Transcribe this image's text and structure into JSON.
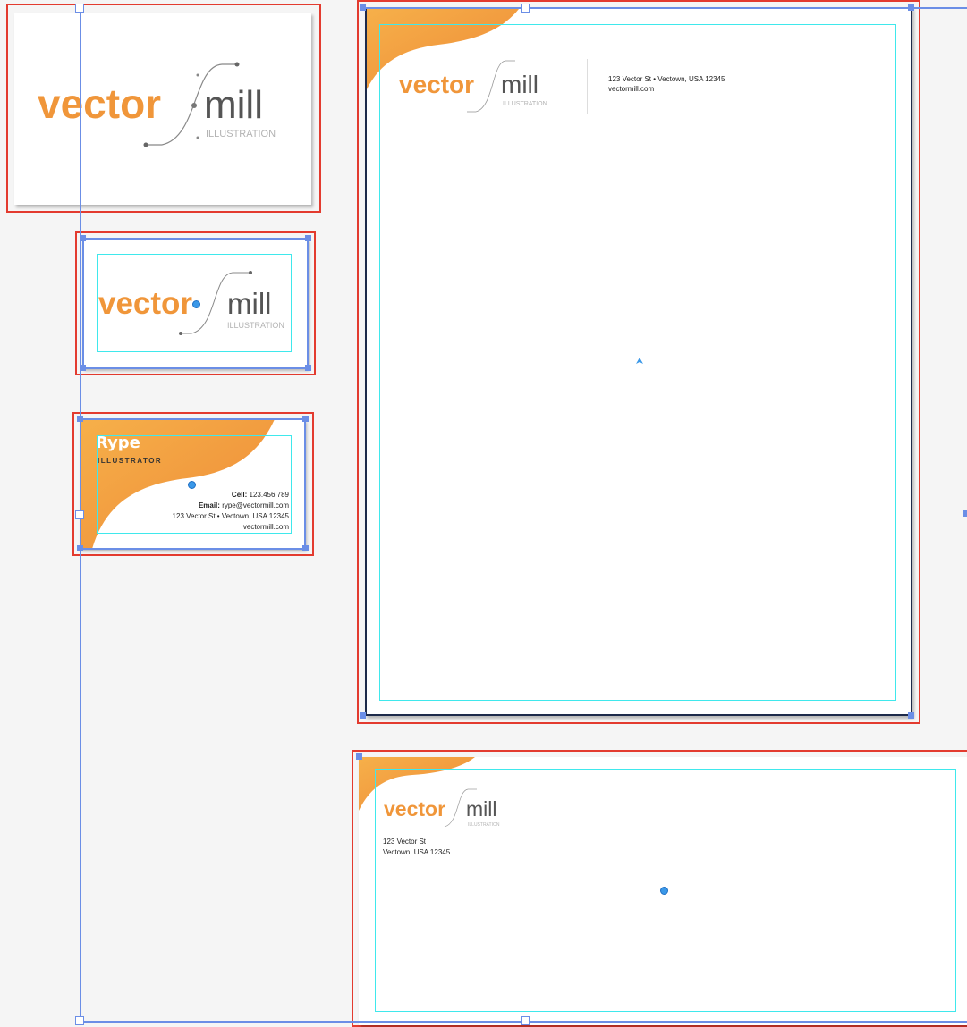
{
  "logo": {
    "word1": "vector",
    "word2": "mill",
    "tagline": "ILLUSTRATION"
  },
  "business_card": {
    "name": "Rype",
    "title": "ILLUSTRATOR",
    "cell_label": "Cell:",
    "cell_value": "123.456.789",
    "email_label": "Email:",
    "email_value": "rype@vectormill.com",
    "address": "123 Vector St • Vectown, USA 12345",
    "website": "vectormill.com"
  },
  "letterhead": {
    "address": "123 Vector St • Vectown, USA 12345",
    "website": "vectormill.com"
  },
  "envelope": {
    "address_line1": "123 Vector St",
    "address_line2": "Vectown, USA 12345"
  },
  "colors": {
    "accent_orange": "#f0963a",
    "artboard_border": "#e33b2f",
    "selection": "#6b8ee6",
    "margin_guide": "#3fe8ec"
  }
}
